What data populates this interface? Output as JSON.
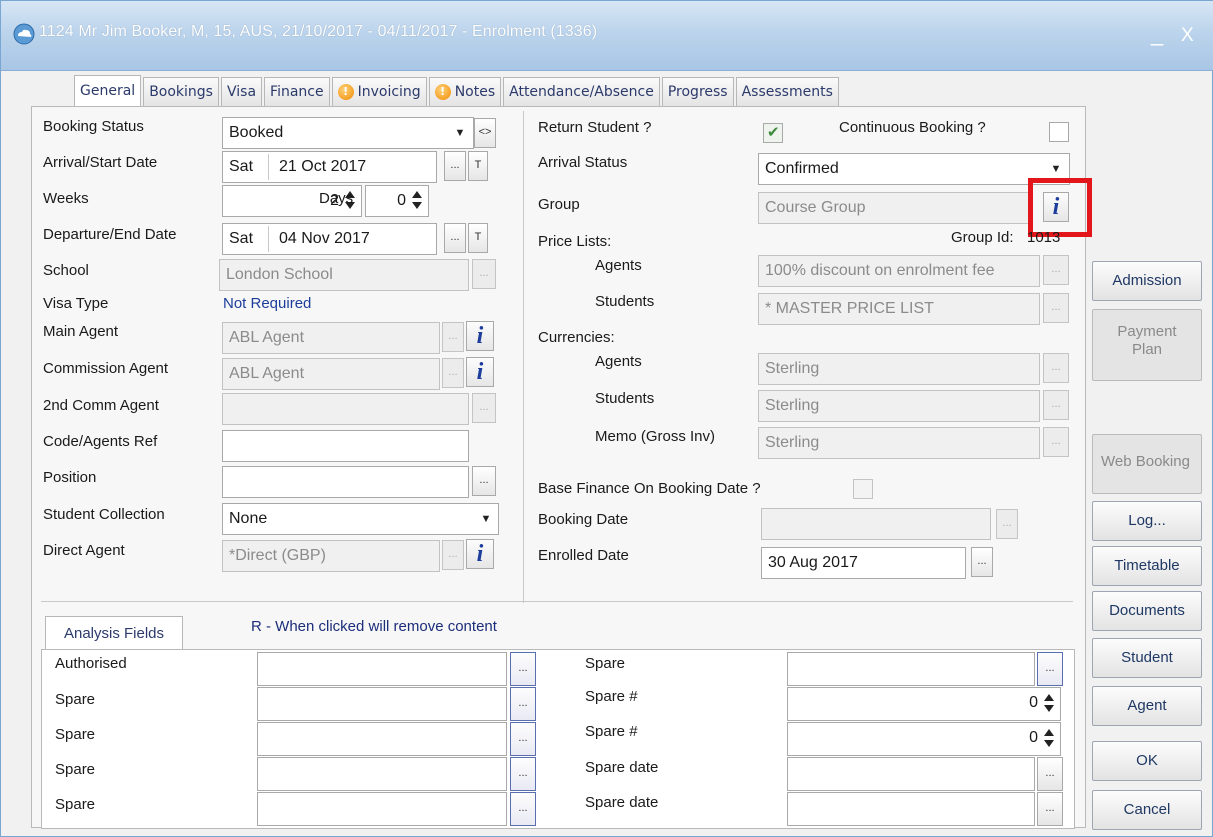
{
  "window": {
    "title": "1124 Mr Jim Booker, M, 15, AUS, 21/10/2017 - 04/11/2017 - Enrolment (1336)",
    "minimize": "_",
    "close": "X"
  },
  "tabs": [
    {
      "label": "General"
    },
    {
      "label": "Bookings"
    },
    {
      "label": "Visa"
    },
    {
      "label": "Finance"
    },
    {
      "label": "Invoicing",
      "warn": true
    },
    {
      "label": "Notes",
      "warn": true
    },
    {
      "label": "Attendance/Absence"
    },
    {
      "label": "Progress"
    },
    {
      "label": "Assessments"
    }
  ],
  "left": {
    "booking_status": {
      "label": "Booking Status",
      "value": "Booked"
    },
    "arrival": {
      "label": "Arrival/Start Date",
      "day": "Sat",
      "date": "21 Oct 2017"
    },
    "weeks": {
      "label": "Weeks",
      "value": "2",
      "days_label": "Days",
      "days_value": "0"
    },
    "departure": {
      "label": "Departure/End Date",
      "day": "Sat",
      "date": "04 Nov 2017"
    },
    "school": {
      "label": "School",
      "value": "London School"
    },
    "visa_type": {
      "label": "Visa Type",
      "value": "Not Required"
    },
    "main_agent": {
      "label": "Main Agent",
      "value": "ABL Agent"
    },
    "commission_agent": {
      "label": "Commission Agent",
      "value": "ABL Agent"
    },
    "second_comm_agent": {
      "label": "2nd Comm Agent",
      "value": ""
    },
    "code_agents_ref": {
      "label": "Code/Agents Ref",
      "value": ""
    },
    "position": {
      "label": "Position",
      "value": ""
    },
    "student_collection": {
      "label": "Student Collection",
      "value": "None"
    },
    "direct_agent": {
      "label": "Direct Agent",
      "value": "*Direct (GBP)"
    }
  },
  "right": {
    "return_student": {
      "label": "Return Student ?",
      "checked": true
    },
    "continuous_booking": {
      "label": "Continuous Booking ?",
      "checked": false
    },
    "arrival_status": {
      "label": "Arrival Status",
      "value": "Confirmed"
    },
    "group": {
      "label": "Group",
      "value": "Course Group"
    },
    "group_id": {
      "label": "Group Id:",
      "value": "1013"
    },
    "price_lists": {
      "label": "Price Lists:"
    },
    "pl_agents": {
      "label": "Agents",
      "value": "100% discount on enrolment fee"
    },
    "pl_students": {
      "label": "Students",
      "value": "* MASTER PRICE LIST"
    },
    "currencies": {
      "label": "Currencies:"
    },
    "cur_agents": {
      "label": "Agents",
      "value": "Sterling"
    },
    "cur_students": {
      "label": "Students",
      "value": "Sterling"
    },
    "cur_memo": {
      "label": "Memo (Gross Inv)",
      "value": "Sterling"
    },
    "base_finance": {
      "label": "Base Finance On Booking Date ?",
      "checked": false
    },
    "booking_date": {
      "label": "Booking Date",
      "value": ""
    },
    "enrolled_date": {
      "label": "Enrolled Date",
      "value": "30 Aug 2017"
    }
  },
  "side_buttons": {
    "admission": "Admission",
    "payment_plan_line1": "Payment",
    "payment_plan_line2": "Plan",
    "web_booking": "Web Booking",
    "log": "Log...",
    "timetable": "Timetable",
    "documents": "Documents",
    "student": "Student",
    "agent": "Agent",
    "ok": "OK",
    "cancel": "Cancel"
  },
  "analysis": {
    "tab_label": "Analysis Fields",
    "note": "R - When clicked will remove content",
    "left_rows": [
      "Authorised",
      "Spare",
      "Spare",
      "Spare",
      "Spare"
    ],
    "right_rows": [
      {
        "label": "Spare",
        "value": ""
      },
      {
        "label": "Spare #",
        "value": "0"
      },
      {
        "label": "Spare #",
        "value": "0"
      },
      {
        "label": "Spare date",
        "value": ""
      },
      {
        "label": "Spare date",
        "value": ""
      }
    ]
  },
  "glyphs": {
    "ellipsis": "...",
    "swap": "<>",
    "today": "T",
    "dropdown": "▼",
    "info": "i"
  },
  "icons": {
    "title": "cloud-icon",
    "info": "info-icon",
    "warning": "warning-icon"
  },
  "colors": {
    "title_bar": "#bcd4ec",
    "link_text": "#1c3d9c",
    "highlight": "#e3161b"
  }
}
